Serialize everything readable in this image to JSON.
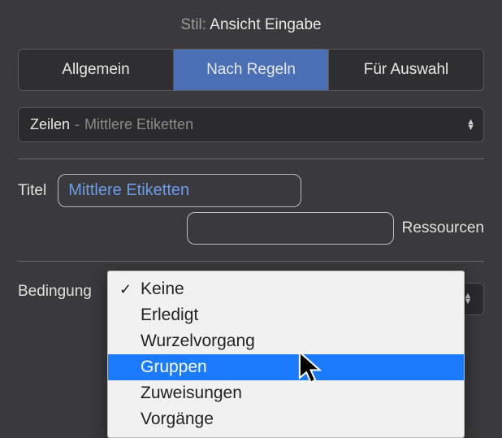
{
  "header": {
    "label": "Stil:",
    "value": "Ansicht Eingabe"
  },
  "tabs": [
    {
      "label": "Allgemein",
      "active": false
    },
    {
      "label": "Nach Regeln",
      "active": true
    },
    {
      "label": "Für Auswahl",
      "active": false
    }
  ],
  "row_selector": {
    "primary": "Zeilen",
    "separator": "-",
    "secondary": "Mittlere Etiketten"
  },
  "title": {
    "label": "Titel",
    "value": "Mittlere Etiketten"
  },
  "resource": {
    "label": "Ressourcen",
    "value": ""
  },
  "condition": {
    "label": "Bedingung"
  },
  "dropdown": {
    "checked_index": 0,
    "highlight_index": 3,
    "items": [
      "Keine",
      "Erledigt",
      "Wurzelvorgang",
      "Gruppen",
      "Zuweisungen",
      "Vorgänge"
    ]
  }
}
